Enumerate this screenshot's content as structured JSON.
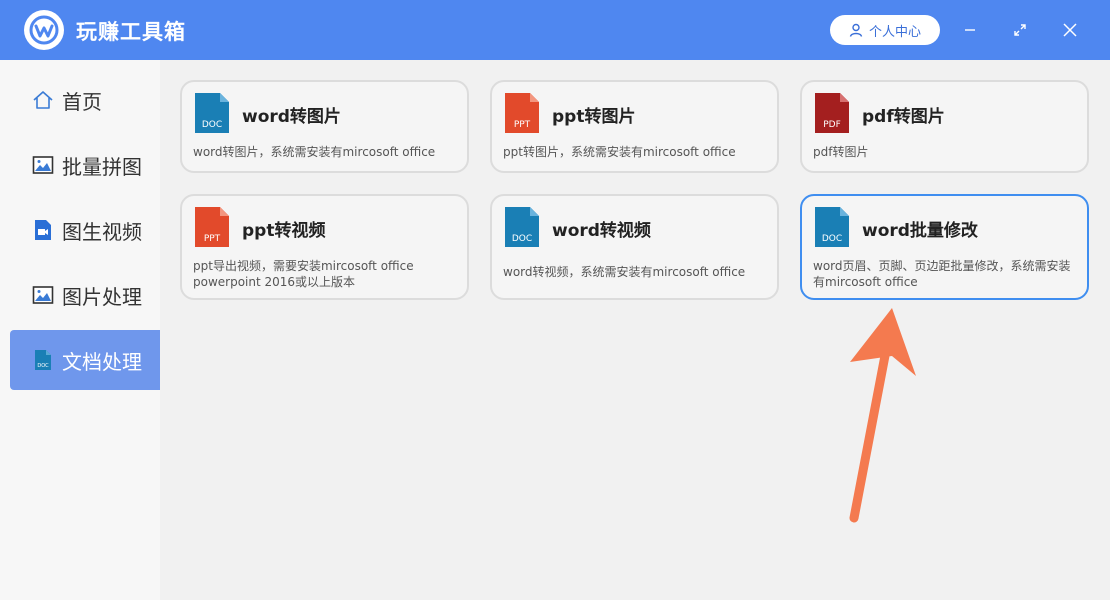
{
  "app": {
    "title": "玩赚工具箱"
  },
  "header": {
    "user_center_label": "个人中心"
  },
  "sidebar": {
    "items": [
      {
        "label": "首页",
        "icon": "home-icon"
      },
      {
        "label": "批量拼图",
        "icon": "image-icon"
      },
      {
        "label": "图生视频",
        "icon": "video-file-icon"
      },
      {
        "label": "图片处理",
        "icon": "image-icon"
      },
      {
        "label": "文档处理",
        "icon": "doc-file-icon",
        "active": true
      }
    ]
  },
  "cards": [
    {
      "title": "word转图片",
      "desc": "word转图片，系统需安装有mircosoft office",
      "type": "DOC",
      "color": "#1a7fb5"
    },
    {
      "title": "ppt转图片",
      "desc": "ppt转图片，系统需安装有mircosoft office",
      "type": "PPT",
      "color": "#e24a2b"
    },
    {
      "title": "pdf转图片",
      "desc": "pdf转图片",
      "type": "PDF",
      "color": "#a41f1f"
    },
    {
      "title": "ppt转视频",
      "desc": "ppt导出视频，需要安装mircosoft office powerpoint 2016或以上版本",
      "type": "PPT",
      "color": "#e24a2b"
    },
    {
      "title": "word转视频",
      "desc": "word转视频，系统需安装有mircosoft office",
      "type": "DOC",
      "color": "#1a7fb5"
    },
    {
      "title": "word批量修改",
      "desc": "word页眉、页脚、页边距批量修改，系统需安装有mircosoft office",
      "type": "DOC",
      "color": "#1a7fb5",
      "selected": true
    }
  ],
  "colors": {
    "header": "#4f87f0",
    "active_nav": "#6f97ec",
    "selected_border": "#3f8ef0",
    "arrow": "#f47a4f"
  }
}
